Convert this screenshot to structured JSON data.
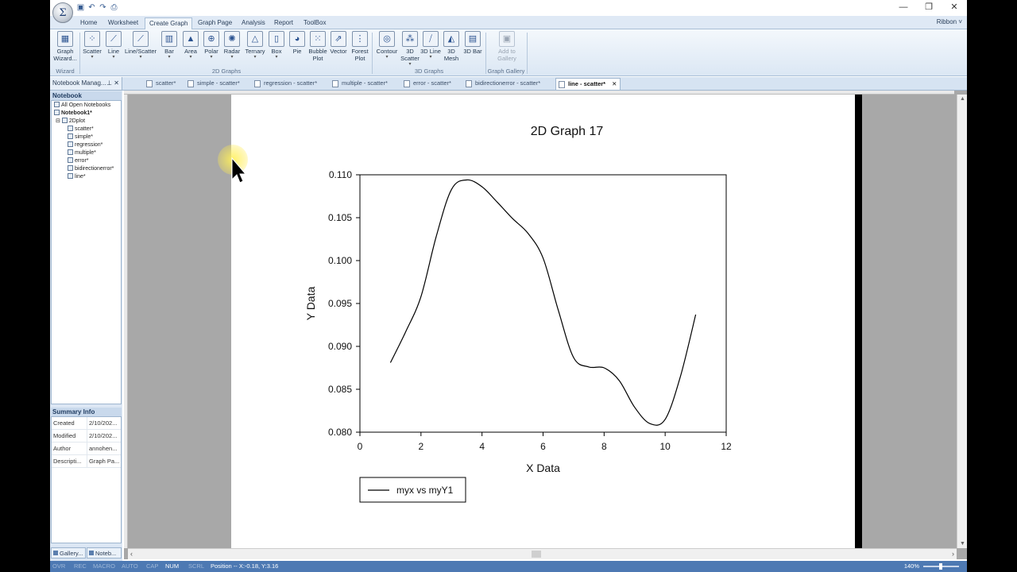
{
  "window": {
    "orb_label": "Σ",
    "qat_icons": [
      "save-icon",
      "undo-icon",
      "redo-icon",
      "print-icon"
    ],
    "controls": [
      "—",
      "❐",
      "✕"
    ]
  },
  "ribbon": {
    "tabs": [
      "Home",
      "Worksheet",
      "Create Graph",
      "Graph Page",
      "Analysis",
      "Report",
      "ToolBox"
    ],
    "active_tab": "Create Graph",
    "right_label": "Ribbon ˅",
    "buttons": {
      "graph_wizard": "Graph Wizard...",
      "scatter": "Scatter",
      "line": "Line",
      "line_scatter": "Line/Scatter",
      "bar": "Bar",
      "area": "Area",
      "polar": "Polar",
      "radar": "Radar",
      "ternary": "Ternary",
      "box": "Box",
      "pie": "Pie",
      "bubble_plot": "Bubble Plot",
      "vector": "Vector",
      "forest_plot": "Forest Plot",
      "contour": "Contour",
      "scatter_3d": "3D Scatter",
      "line_3d": "3D Line",
      "mesh_3d": "3D Mesh",
      "bar_3d": "3D Bar",
      "add_to_gallery": "Add to Gallery"
    },
    "groups": {
      "wizard": "Wizard",
      "graphs_2d": "2D Graphs",
      "graphs_3d": "3D Graphs",
      "gallery": "Graph Gallery"
    }
  },
  "docbar": {
    "pane_title": "Notebook Manag...",
    "tabs": [
      "scatter*",
      "simple - scatter*",
      "regression - scatter*",
      "multiple - scatter*",
      "error - scatter*",
      "bidirectionerror - scatter*",
      "line - scatter*"
    ],
    "active_tab": "line - scatter*"
  },
  "notebook": {
    "header": "Notebook",
    "tree": {
      "all_open": "All Open Notebooks",
      "notebook": "Notebook1*",
      "section": "2Dplot",
      "items": [
        "scatter*",
        "simple*",
        "regression*",
        "multiple*",
        "error*",
        "bidirectionerror*",
        "line*"
      ]
    }
  },
  "summary": {
    "header": "Summary Info",
    "rows": [
      {
        "key": "Created",
        "value": "2/10/202..."
      },
      {
        "key": "Modified",
        "value": "2/10/202..."
      },
      {
        "key": "Author",
        "value": "annohen..."
      },
      {
        "key": "Descripti...",
        "value": "Graph Pa..."
      }
    ]
  },
  "bottom_tabs": [
    "Gallery...",
    "Noteb..."
  ],
  "chart_data": {
    "type": "line",
    "title": "2D Graph 17",
    "xlabel": "X Data",
    "ylabel": "Y Data",
    "xlim": [
      0,
      12
    ],
    "ylim": [
      0.08,
      0.11
    ],
    "xticks": [
      "0",
      "2",
      "4",
      "6",
      "8",
      "10",
      "12"
    ],
    "yticks": [
      "0.080",
      "0.085",
      "0.090",
      "0.095",
      "0.100",
      "0.105",
      "0.110"
    ],
    "grid": false,
    "legend": "bottom-left",
    "series": [
      {
        "name": "myx vs myY1",
        "color": "#000000",
        "x": [
          1.0,
          1.5,
          2.0,
          2.5,
          3.0,
          3.5,
          4.0,
          4.5,
          5.0,
          5.5,
          6.0,
          6.5,
          7.0,
          7.5,
          8.0,
          8.5,
          9.0,
          9.5,
          10.0,
          10.5,
          11.0
        ],
        "y": [
          0.0881,
          0.0917,
          0.0958,
          0.1028,
          0.1083,
          0.1094,
          0.1086,
          0.1068,
          0.1049,
          0.1032,
          0.1003,
          0.0942,
          0.0887,
          0.0876,
          0.0875,
          0.086,
          0.0829,
          0.081,
          0.0815,
          0.0865,
          0.0937
        ]
      }
    ]
  },
  "status": {
    "indicators": [
      "OVR",
      "REC",
      "MACRO",
      "AUTO",
      "CAP",
      "NUM",
      "SCRL"
    ],
    "active": [
      "NUM"
    ],
    "position": "Position -- X:-0.18, Y:3.16",
    "zoom": "140%"
  }
}
